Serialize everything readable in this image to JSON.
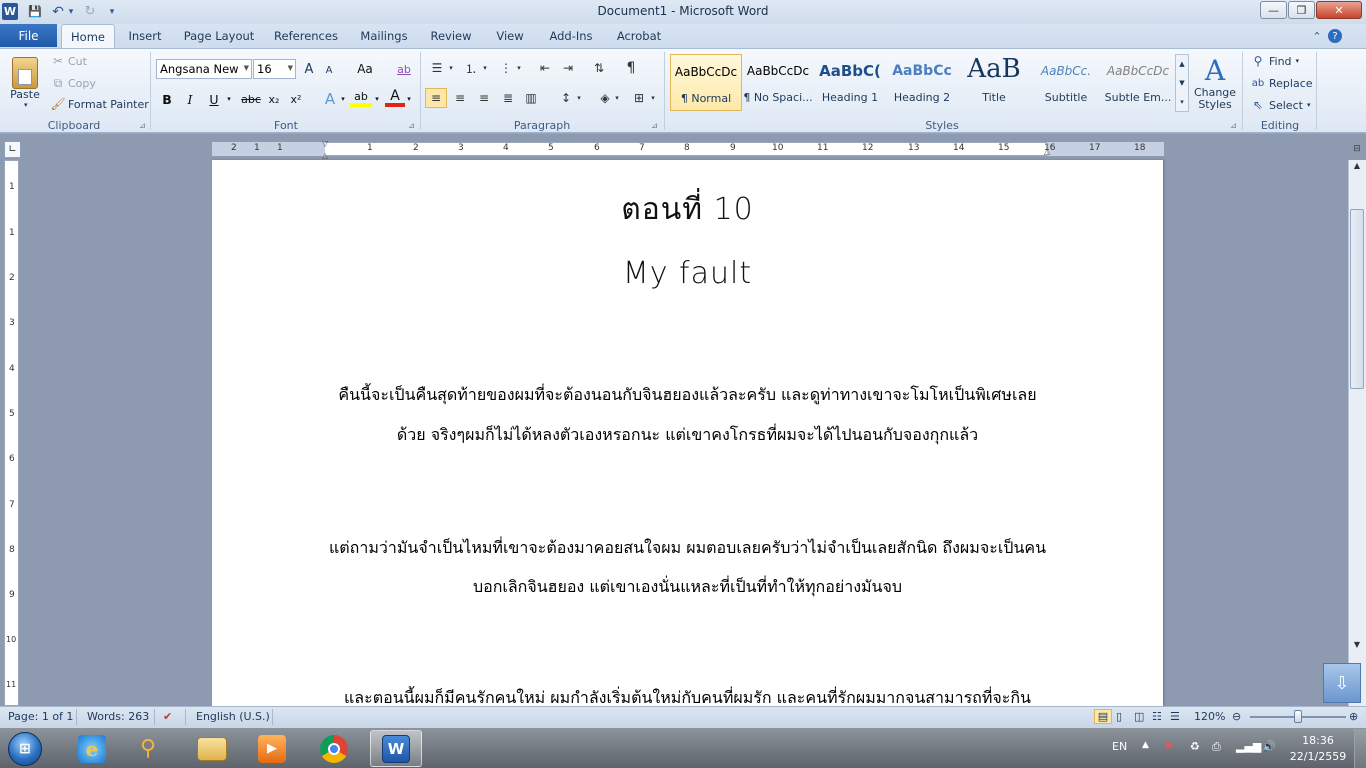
{
  "window": {
    "title": "Document1 - Microsoft Word",
    "app_icon": "W",
    "minimize": "—",
    "maximize": "❐",
    "close": "✕"
  },
  "qat": {
    "save": "💾",
    "undo": "↶",
    "undo_dd": "▾",
    "redo": "↻",
    "customize": "▾"
  },
  "tabs": [
    {
      "label": "File"
    },
    {
      "label": "Home"
    },
    {
      "label": "Insert"
    },
    {
      "label": "Page Layout"
    },
    {
      "label": "References"
    },
    {
      "label": "Mailings"
    },
    {
      "label": "Review"
    },
    {
      "label": "View"
    },
    {
      "label": "Add-Ins"
    },
    {
      "label": "Acrobat"
    }
  ],
  "active_tab": "Home",
  "ribbon": {
    "clipboard": {
      "label": "Clipboard",
      "paste": "Paste",
      "cut": "Cut",
      "copy": "Copy",
      "format_painter": "Format Painter"
    },
    "font": {
      "label": "Font",
      "font_name": "Angsana New",
      "font_size": "16",
      "grow": "A",
      "shrink": "A",
      "change_case": "Aa",
      "clear": "ab",
      "bold": "B",
      "italic": "I",
      "underline": "U",
      "strike": "abc",
      "sub": "x₂",
      "sup": "x²",
      "text_effects": "A",
      "highlight": "ab",
      "font_color": "A"
    },
    "paragraph": {
      "label": "Paragraph",
      "show_marks": "¶"
    },
    "styles": {
      "label": "Styles",
      "items": [
        {
          "sample": "AaBbCcDc",
          "name": "¶ Normal"
        },
        {
          "sample": "AaBbCcDc",
          "name": "¶ No Spaci..."
        },
        {
          "sample": "AaBbC(",
          "name": "Heading 1"
        },
        {
          "sample": "AaBbCc",
          "name": "Heading 2"
        },
        {
          "sample": "AaB",
          "name": "Title"
        },
        {
          "sample": "AaBbCc.",
          "name": "Subtitle"
        },
        {
          "sample": "AaBbCcDc",
          "name": "Subtle Em..."
        }
      ],
      "change_styles": "Change Styles",
      "change_styles_line1": "Change",
      "change_styles_line2": "Styles"
    },
    "editing": {
      "label": "Editing",
      "find": "Find",
      "replace": "Replace",
      "select": "Select"
    }
  },
  "ruler": {
    "h_numbers": [
      "2",
      "1",
      "1",
      "1",
      "2",
      "3",
      "4",
      "5",
      "6",
      "7",
      "8",
      "9",
      "10",
      "11",
      "12",
      "13",
      "14",
      "15",
      "16",
      "17",
      "18"
    ],
    "v_numbers": [
      "1",
      "1",
      "2",
      "3",
      "4",
      "5",
      "6",
      "7",
      "8",
      "9",
      "10",
      "11"
    ]
  },
  "document": {
    "title1": "ตอนที่ 10",
    "title2": "My fault",
    "lines": [
      "คืนนี้จะเป็นคืนสุดท้ายของผมที่จะต้องนอนกับจินฮยองแล้วละครับ และดูท่าทางเขาจะโมโหเป็นพิเศษเลย",
      "ด้วย จริงๆผมก็ไม่ได้หลงตัวเองหรอกนะ แต่เขาคงโกรธที่ผมจะได้ไปนอนกับจองกุกแล้ว",
      "แต่ถามว่ามันจำเป็นไหมที่เขาจะต้องมาคอยสนใจผม ผมตอบเลยครับว่าไม่จำเป็นเลยสักนิด ถึงผมจะเป็นคน",
      "บอกเลิกจินฮยอง แต่เขาเองนั่นแหละที่เป็นที่ทำให้ทุกอย่างมันจบ",
      "และตอนนี้ผมก็มีคนรักคนใหม่ ผมกำลังเริ่มต้นใหม่กับคนที่ผมรัก และคนที่รักผมมากจนสามารถที่จะกิน"
    ]
  },
  "statusbar": {
    "page": "Page: 1 of 1",
    "words": "Words: 263",
    "language": "English (U.S.)",
    "zoom": "120%",
    "zoom_level": 0.5
  },
  "taskbar": {
    "language": "EN",
    "time": "18:36",
    "date": "22/1/2559"
  }
}
